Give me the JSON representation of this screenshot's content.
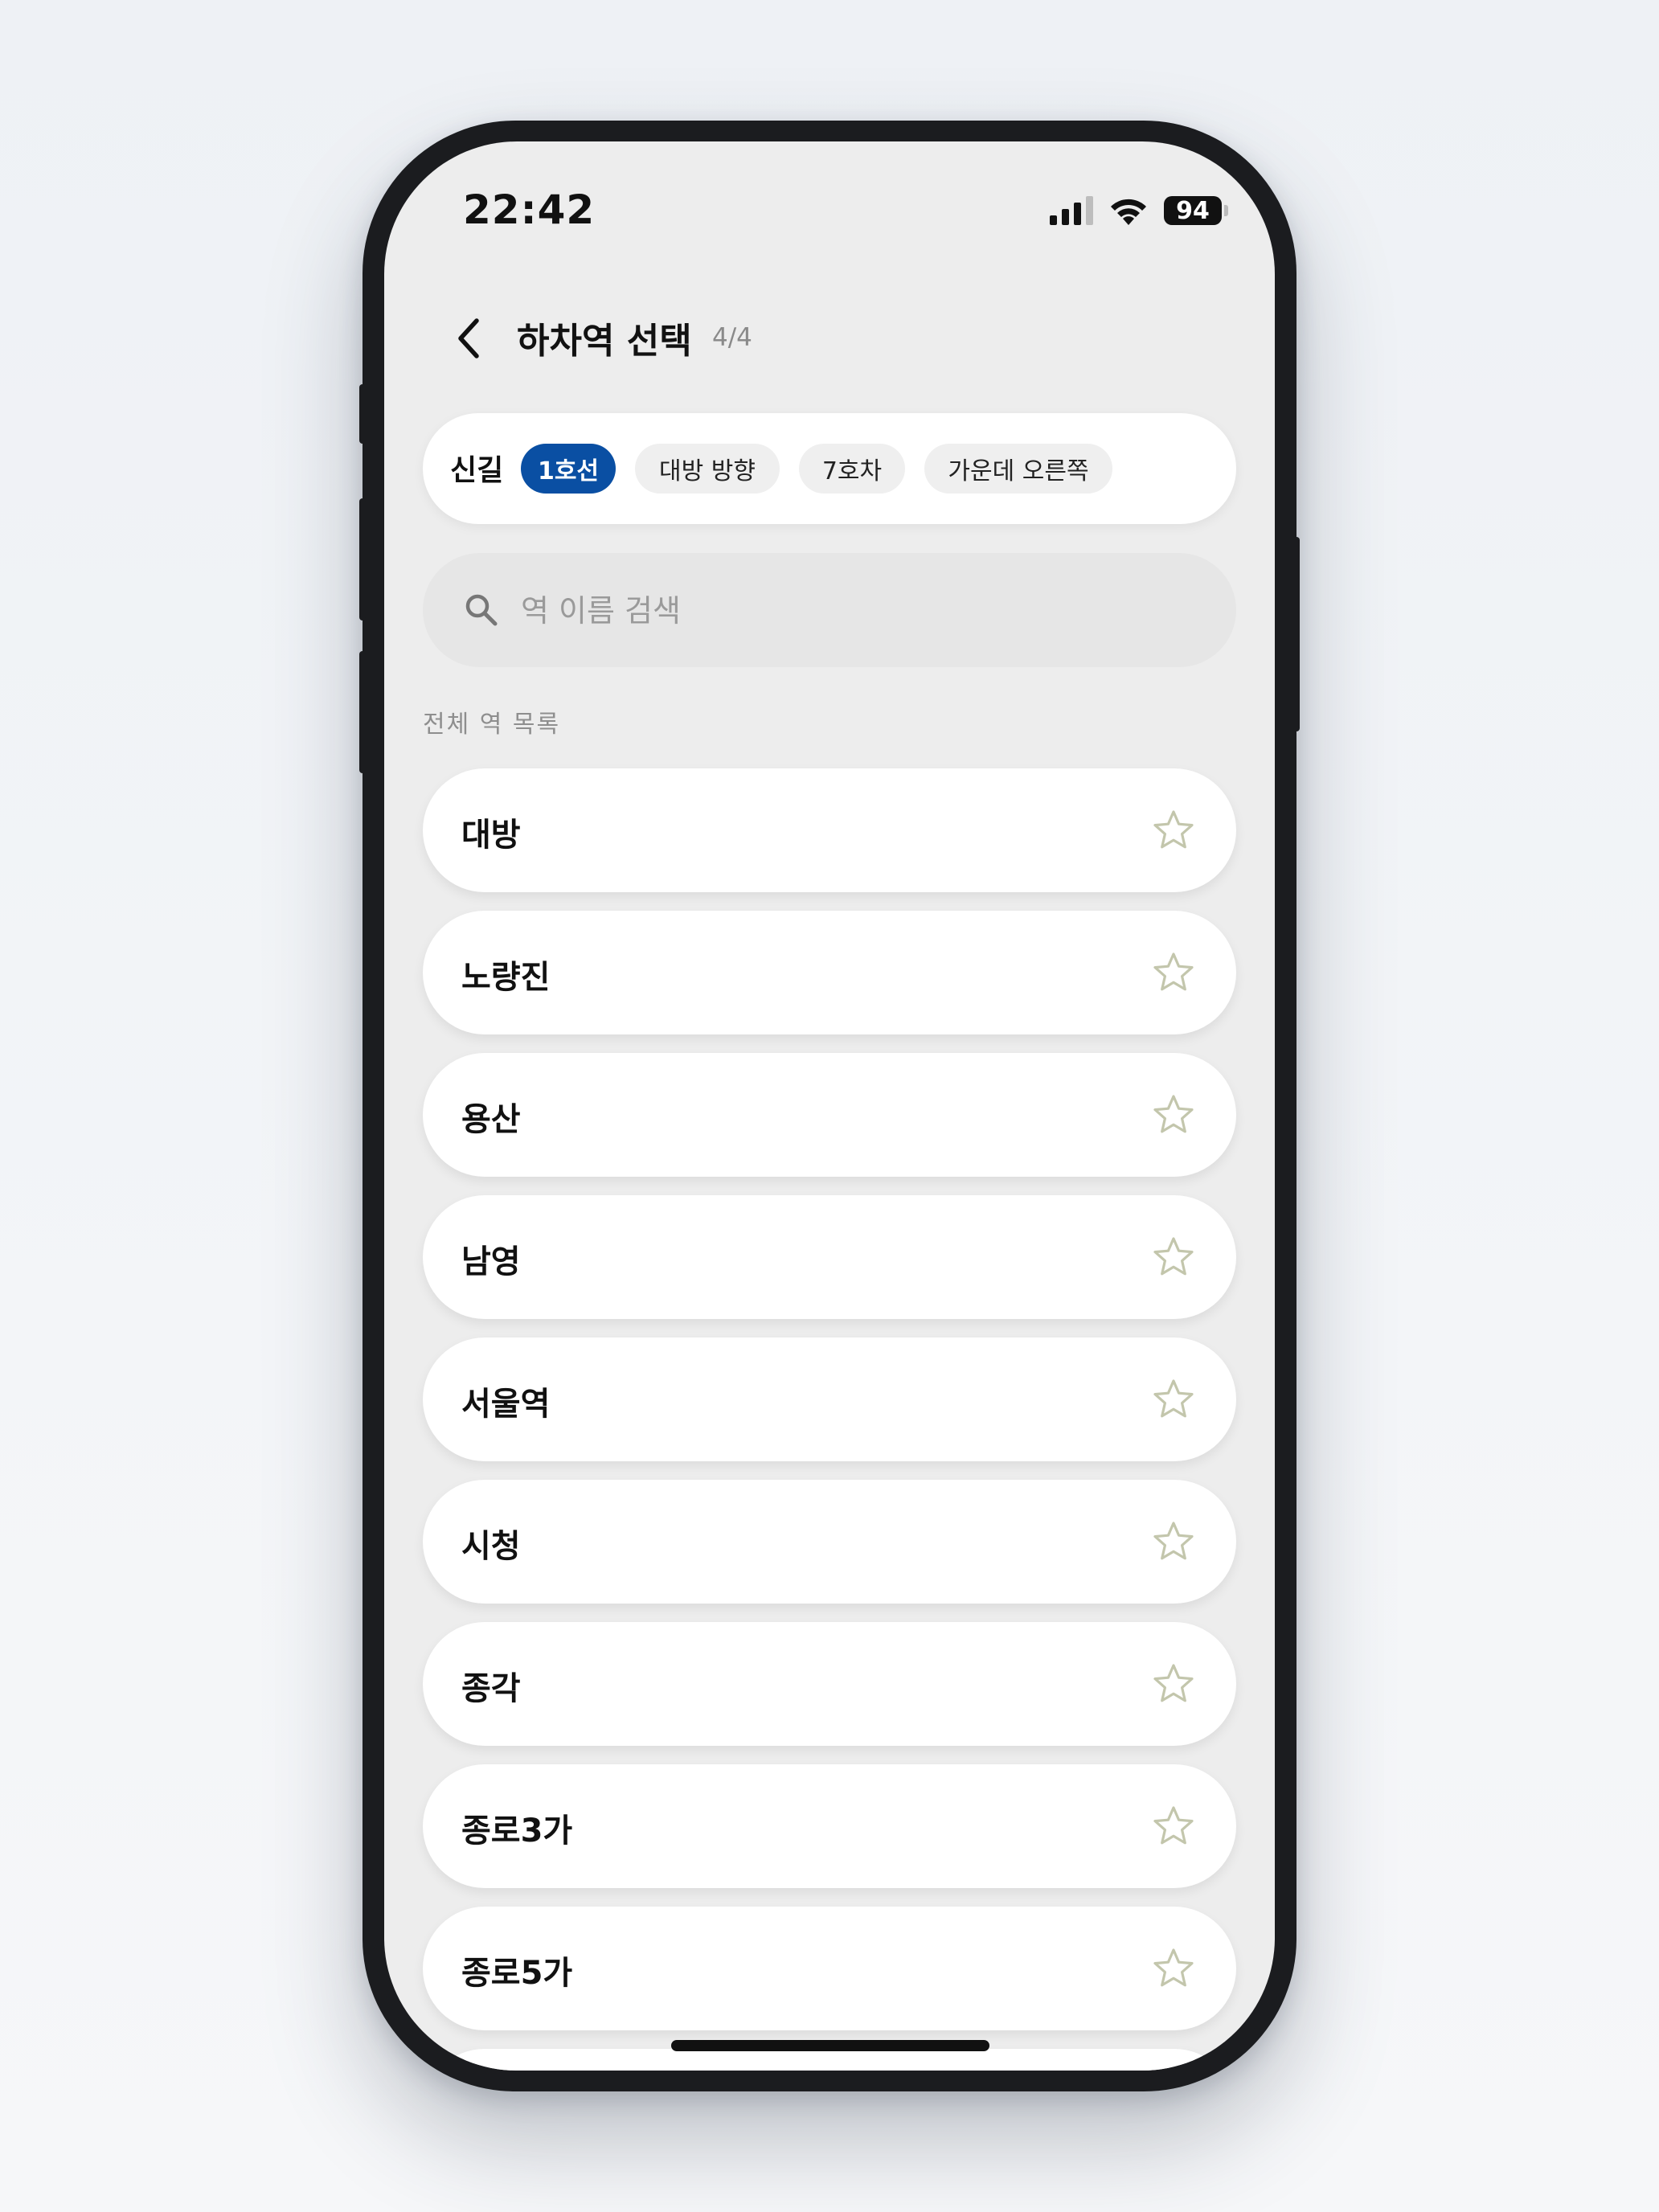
{
  "status_bar": {
    "time": "22:42",
    "battery": "94",
    "icons": [
      "signal-icon",
      "wifi-icon",
      "battery-icon"
    ]
  },
  "header": {
    "back_icon": "chevron-left-icon",
    "title": "하차역 선택",
    "step": "4/4"
  },
  "summary": {
    "label": "신길",
    "chips": [
      {
        "label": "1호선",
        "active": true
      },
      {
        "label": "대방 방향",
        "active": false
      },
      {
        "label": "7호차",
        "active": false
      },
      {
        "label": "가운데 오른쪽",
        "active": false
      }
    ]
  },
  "search": {
    "icon": "search-icon",
    "placeholder": "역 이름 검색",
    "value": ""
  },
  "list": {
    "section_label": "전체 역 목록",
    "items": [
      {
        "label": "대방"
      },
      {
        "label": "노량진"
      },
      {
        "label": "용산"
      },
      {
        "label": "남영"
      },
      {
        "label": "서울역"
      },
      {
        "label": "시청"
      },
      {
        "label": "종각"
      },
      {
        "label": "종로3가"
      },
      {
        "label": "종로5가"
      }
    ],
    "favorite_icon": "star-outline-icon"
  },
  "colors": {
    "accent": "#0a4fa3",
    "star": "#c3c6ac",
    "screen_bg": "#ededed"
  }
}
